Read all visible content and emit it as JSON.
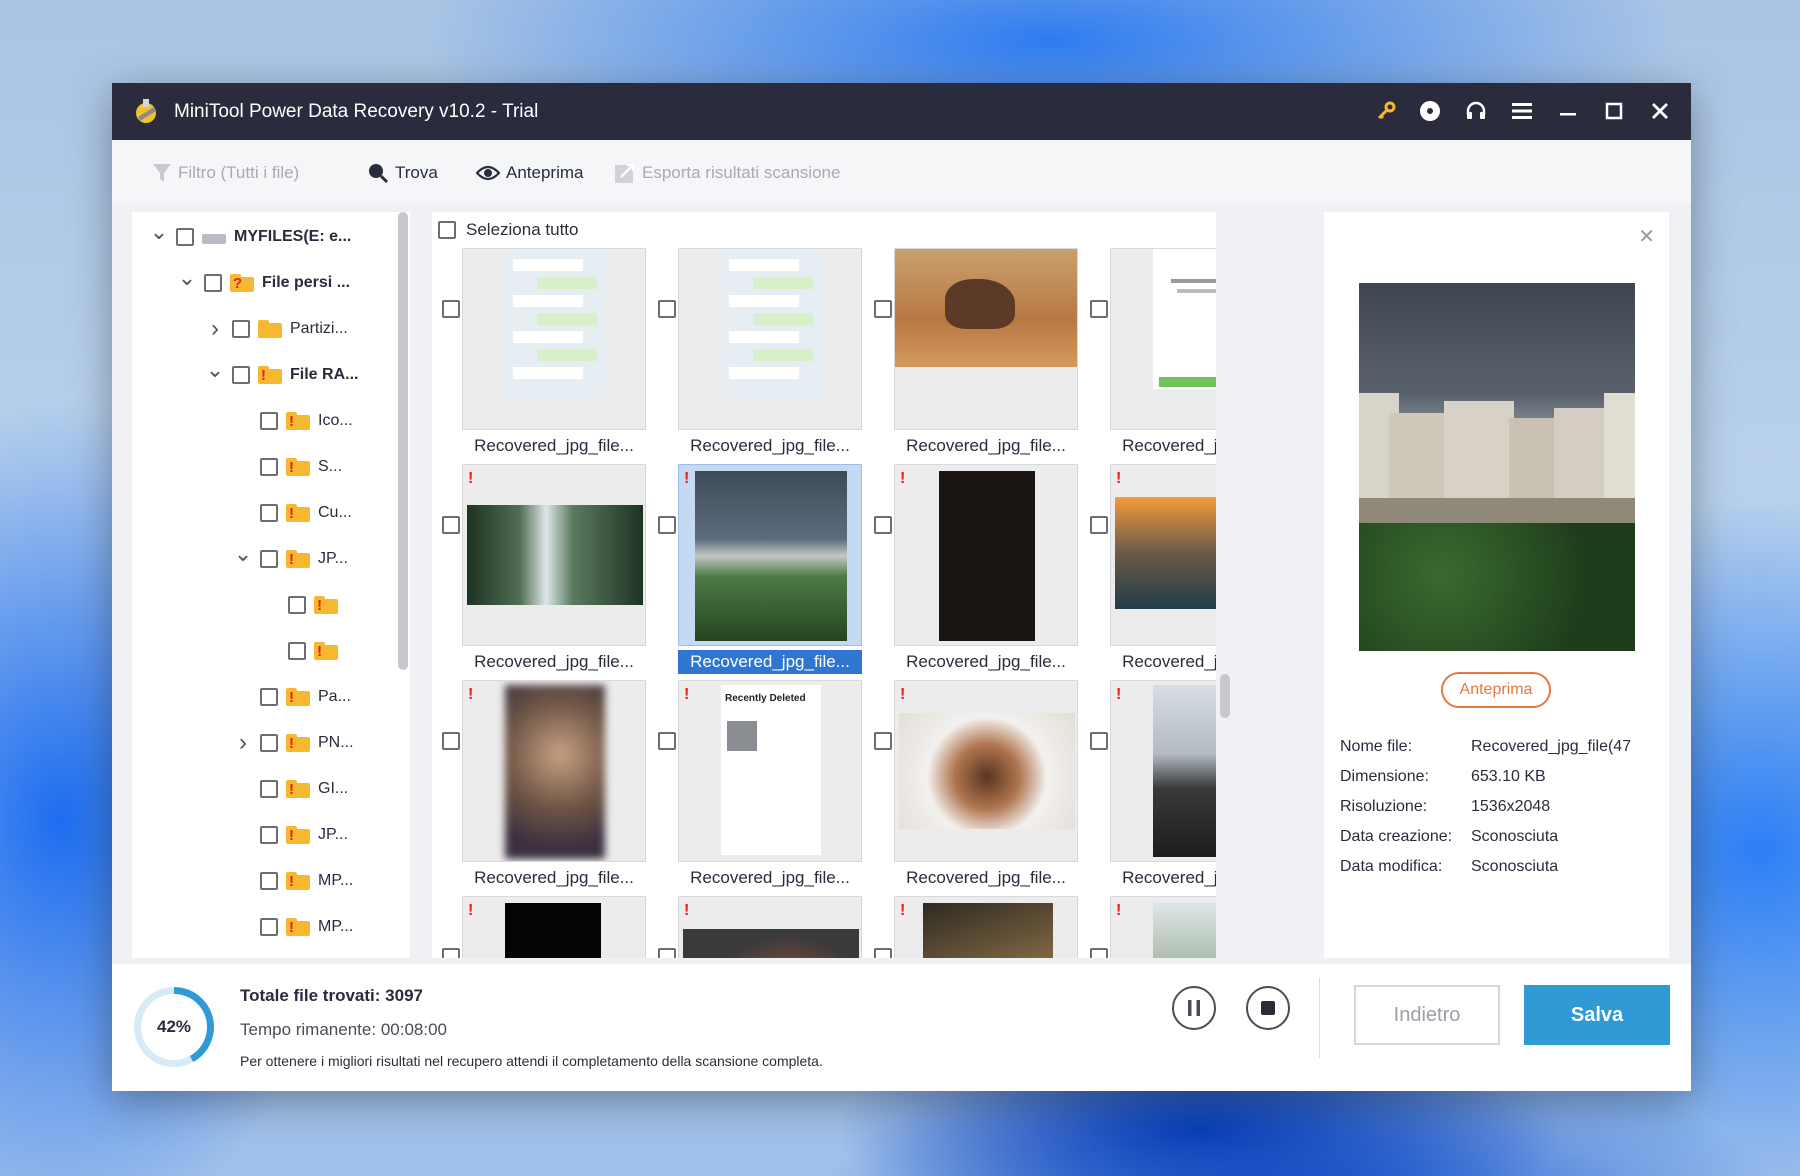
{
  "window": {
    "title": "MiniTool Power Data Recovery v10.2 - Trial"
  },
  "toolbar": {
    "filter": "Filtro (Tutti i file)",
    "find": "Trova",
    "preview": "Anteprima",
    "export": "Esporta risultati scansione"
  },
  "tree": [
    {
      "label": "MYFILES(E: e...",
      "level": 0,
      "chevron": "down",
      "icon": "drive-icon",
      "bold": true
    },
    {
      "label": "File persi ...",
      "level": 1,
      "chevron": "down",
      "icon": "lost-folder-icon",
      "bold": true
    },
    {
      "label": "Partizi...",
      "level": 2,
      "chevron": "right",
      "icon": "folder-icon"
    },
    {
      "label": "File RA...",
      "level": 2,
      "chevron": "down",
      "icon": "raw-folder-icon",
      "bold": true
    },
    {
      "label": "Ico...",
      "level": 3,
      "chevron": "",
      "icon": "raw-folder-icon"
    },
    {
      "label": "S...",
      "level": 3,
      "chevron": "",
      "icon": "raw-folder-icon"
    },
    {
      "label": "Cu...",
      "level": 3,
      "chevron": "",
      "icon": "raw-folder-icon"
    },
    {
      "label": "JP...",
      "level": 3,
      "chevron": "down",
      "icon": "raw-folder-icon"
    },
    {
      "label": "",
      "level": 4,
      "chevron": "",
      "icon": "raw-folder-icon"
    },
    {
      "label": "",
      "level": 4,
      "chevron": "",
      "icon": "raw-folder-icon"
    },
    {
      "label": "Pa...",
      "level": 3,
      "chevron": "",
      "icon": "raw-folder-icon"
    },
    {
      "label": "PN...",
      "level": 3,
      "chevron": "right",
      "icon": "raw-folder-icon"
    },
    {
      "label": "GI...",
      "level": 3,
      "chevron": "",
      "icon": "raw-folder-icon"
    },
    {
      "label": "JP...",
      "level": 3,
      "chevron": "",
      "icon": "raw-folder-icon"
    },
    {
      "label": "MP...",
      "level": 3,
      "chevron": "",
      "icon": "raw-folder-icon"
    },
    {
      "label": "MP...",
      "level": 3,
      "chevron": "",
      "icon": "raw-folder-icon"
    }
  ],
  "grid": {
    "select_all": "Seleziona tutto",
    "items": [
      {
        "name": "Recovered_jpg_file...",
        "thumb": "chat-screenshot",
        "warn": false,
        "selected": false
      },
      {
        "name": "Recovered_jpg_file...",
        "thumb": "chat-screenshot",
        "warn": false,
        "selected": false
      },
      {
        "name": "Recovered_jpg_file...",
        "thumb": "elephant",
        "warn": false,
        "selected": false
      },
      {
        "name": "Recovered_jpg_file...",
        "thumb": "phone-page",
        "warn": false,
        "selected": false
      },
      {
        "name": "Recovered_jpg_file...",
        "thumb": "waterfall",
        "warn": true,
        "selected": false
      },
      {
        "name": "Recovered_jpg_file...",
        "thumb": "city-sky",
        "warn": true,
        "selected": true
      },
      {
        "name": "Recovered_jpg_file...",
        "thumb": "dark-phone",
        "warn": true,
        "selected": false
      },
      {
        "name": "Recovered_jpg_file...",
        "thumb": "kids-sunset",
        "warn": true,
        "selected": false
      },
      {
        "name": "Recovered_jpg_file...",
        "thumb": "blurred-face",
        "warn": true,
        "selected": false
      },
      {
        "name": "Recovered_jpg_file...",
        "thumb": "recently-deleted",
        "warn": true,
        "selected": false
      },
      {
        "name": "Recovered_jpg_file...",
        "thumb": "dog",
        "warn": true,
        "selected": false
      },
      {
        "name": "Recovered_jpg_file...",
        "thumb": "couple",
        "warn": true,
        "selected": false
      },
      {
        "name": "",
        "thumb": "black",
        "warn": true,
        "selected": false
      },
      {
        "name": "",
        "thumb": "fox",
        "warn": true,
        "selected": false
      },
      {
        "name": "",
        "thumb": "bird",
        "warn": true,
        "selected": false
      },
      {
        "name": "",
        "thumb": "trees",
        "warn": true,
        "selected": false
      }
    ],
    "thumb_text": {
      "recently_deleted": "Recently Deleted"
    }
  },
  "preview": {
    "button": "Anteprima",
    "fields": [
      {
        "k": "Nome file:",
        "v": "Recovered_jpg_file(47"
      },
      {
        "k": "Dimensione:",
        "v": "653.10 KB"
      },
      {
        "k": "Risoluzione:",
        "v": "1536x2048"
      },
      {
        "k": "Data creazione:",
        "v": "Sconosciuta"
      },
      {
        "k": "Data modifica:",
        "v": "Sconosciuta"
      }
    ]
  },
  "footer": {
    "progress": 0.42,
    "progress_label": "42%",
    "total_label": "Totale file trovati:",
    "total_value": "3097",
    "time_label": "Tempo rimanente:",
    "time_value": "00:08:00",
    "hint": "Per ottenere i migliori risultati nel recupero attendi il completamento della scansione completa.",
    "back": "Indietro",
    "save": "Salva"
  },
  "colors": {
    "accent": "#2f9ad6",
    "titlebar": "#2a2c3e",
    "warning": "#e42020",
    "preview_btn": "#e8773f",
    "selection": "#2f76d3"
  }
}
